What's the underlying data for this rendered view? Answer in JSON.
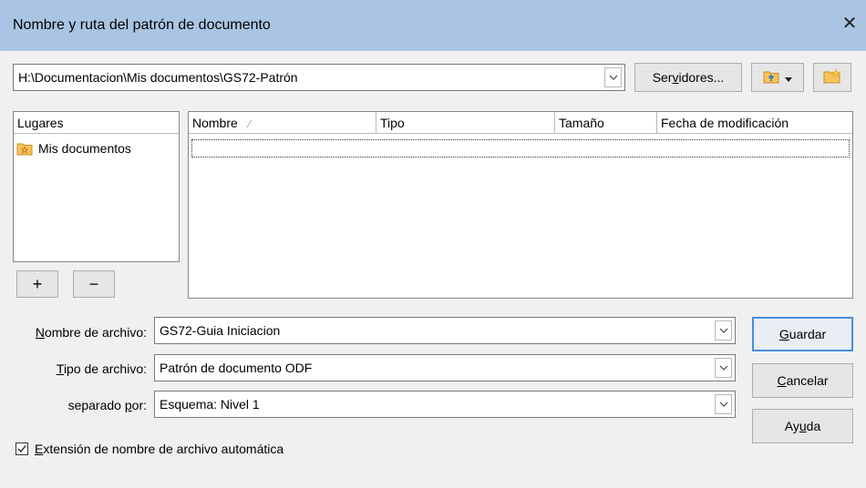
{
  "dialog": {
    "title": "Nombre y ruta del patrón de documento"
  },
  "path": {
    "value": "H:\\Documentacion\\Mis documentos\\GS72-Patrón"
  },
  "toolbar": {
    "servers_label_pre": "Ser",
    "servers_label_u": "v",
    "servers_label_post": "idores..."
  },
  "places": {
    "header": "Lugares",
    "items": [
      {
        "label": "Mis documentos"
      }
    ],
    "add_label": "+",
    "remove_label": "−"
  },
  "files": {
    "columns": [
      {
        "label": "Nombre"
      },
      {
        "label": "Tipo"
      },
      {
        "label": "Tamaño"
      },
      {
        "label": "Fecha de modificación"
      }
    ],
    "sort_indicator": "⁄"
  },
  "form": {
    "filename": {
      "label_u": "N",
      "label_rest": "ombre de archivo:",
      "value": "GS72-Guia Iniciacion"
    },
    "filetype": {
      "label_u": "T",
      "label_rest": "ipo de archivo:",
      "value": "Patrón de documento ODF"
    },
    "separated": {
      "label_pre": "separado ",
      "label_u": "p",
      "label_post": "or:",
      "value": "Esquema: Nivel 1"
    }
  },
  "buttons": {
    "save": {
      "u": "G",
      "rest": "uardar"
    },
    "cancel": {
      "u": "C",
      "rest": "ancelar"
    },
    "help": {
      "pre": "Ay",
      "u": "u",
      "post": "da"
    }
  },
  "auto_ext": {
    "checked": true,
    "label_u": "E",
    "label_rest": "xtensión de nombre de archivo automática"
  }
}
